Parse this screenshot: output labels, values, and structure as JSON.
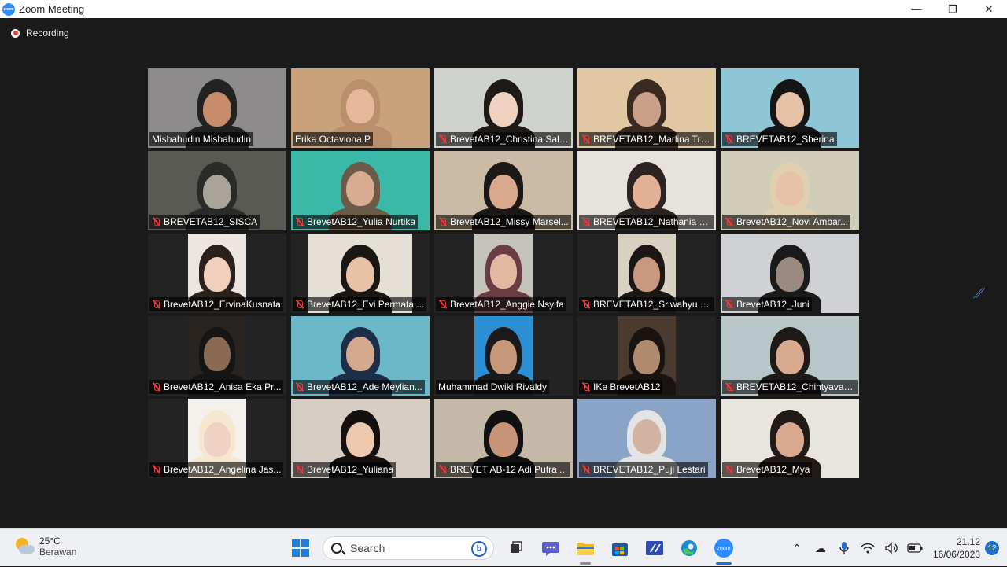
{
  "window": {
    "title": "Zoom Meeting",
    "app_icon": "zoom-logo",
    "logo_text": "zoom"
  },
  "meeting": {
    "recording_label": "Recording",
    "participants": [
      "Misbahudin Misbahudin",
      "Erika Octaviona P",
      "BrevetAB12_Christina Sali...",
      "BREVETAB12_Marlina Trip...",
      "BREVETAB12_Sherina",
      "BREVETAB12_SISCA",
      "BrevetAB12_Yulia Nurtika",
      "BrevetAB12_Missy Marsel...",
      "BREVETAB12_Nathania Jun...",
      "BrevetAB12_Novi Ambar...",
      "BrevetAB12_ErvinaKusnata",
      "BrevetAB12_Evi Permata ...",
      "BrevetAB12_Anggie Nsyifa",
      "BREVETAB12_Sriwahyu Tj...",
      "BrevetAB12_Juni",
      "BrevetAB12_Anisa Eka Pr...",
      "BrevetAB12_Ade Meylian...",
      "Muhammad Dwiki Rivaldy",
      "IKe BrevetAB12",
      "BREVETAB12_Chintyavan...",
      "BrevetAB12_Angelina Jas...",
      "BrevetAB12_Yuliana",
      "BREVET AB-12 Adi Putra ...",
      "BREVETAB12_Puji Lestari",
      "BrevetAB12_Mya"
    ],
    "muted": [
      false,
      false,
      true,
      true,
      true,
      true,
      true,
      true,
      true,
      true,
      true,
      true,
      true,
      true,
      true,
      true,
      true,
      false,
      true,
      true,
      true,
      true,
      true,
      true,
      true
    ],
    "active_speaker_index": 1,
    "highlight_color": "#d8e84a",
    "muted_color": "#e03e3e"
  },
  "taskbar": {
    "weather": {
      "temp": "25°C",
      "condition": "Berawan"
    },
    "search_placeholder": "Search",
    "pinned": [
      "task-view-icon",
      "teams-chat-icon",
      "file-explorer-icon",
      "microsoft-store-icon",
      "visual-studio-icon",
      "edge-icon",
      "zoom-icon"
    ],
    "clock": {
      "time": "21.12",
      "date": "16/06/2023"
    },
    "notification_count": "12"
  }
}
